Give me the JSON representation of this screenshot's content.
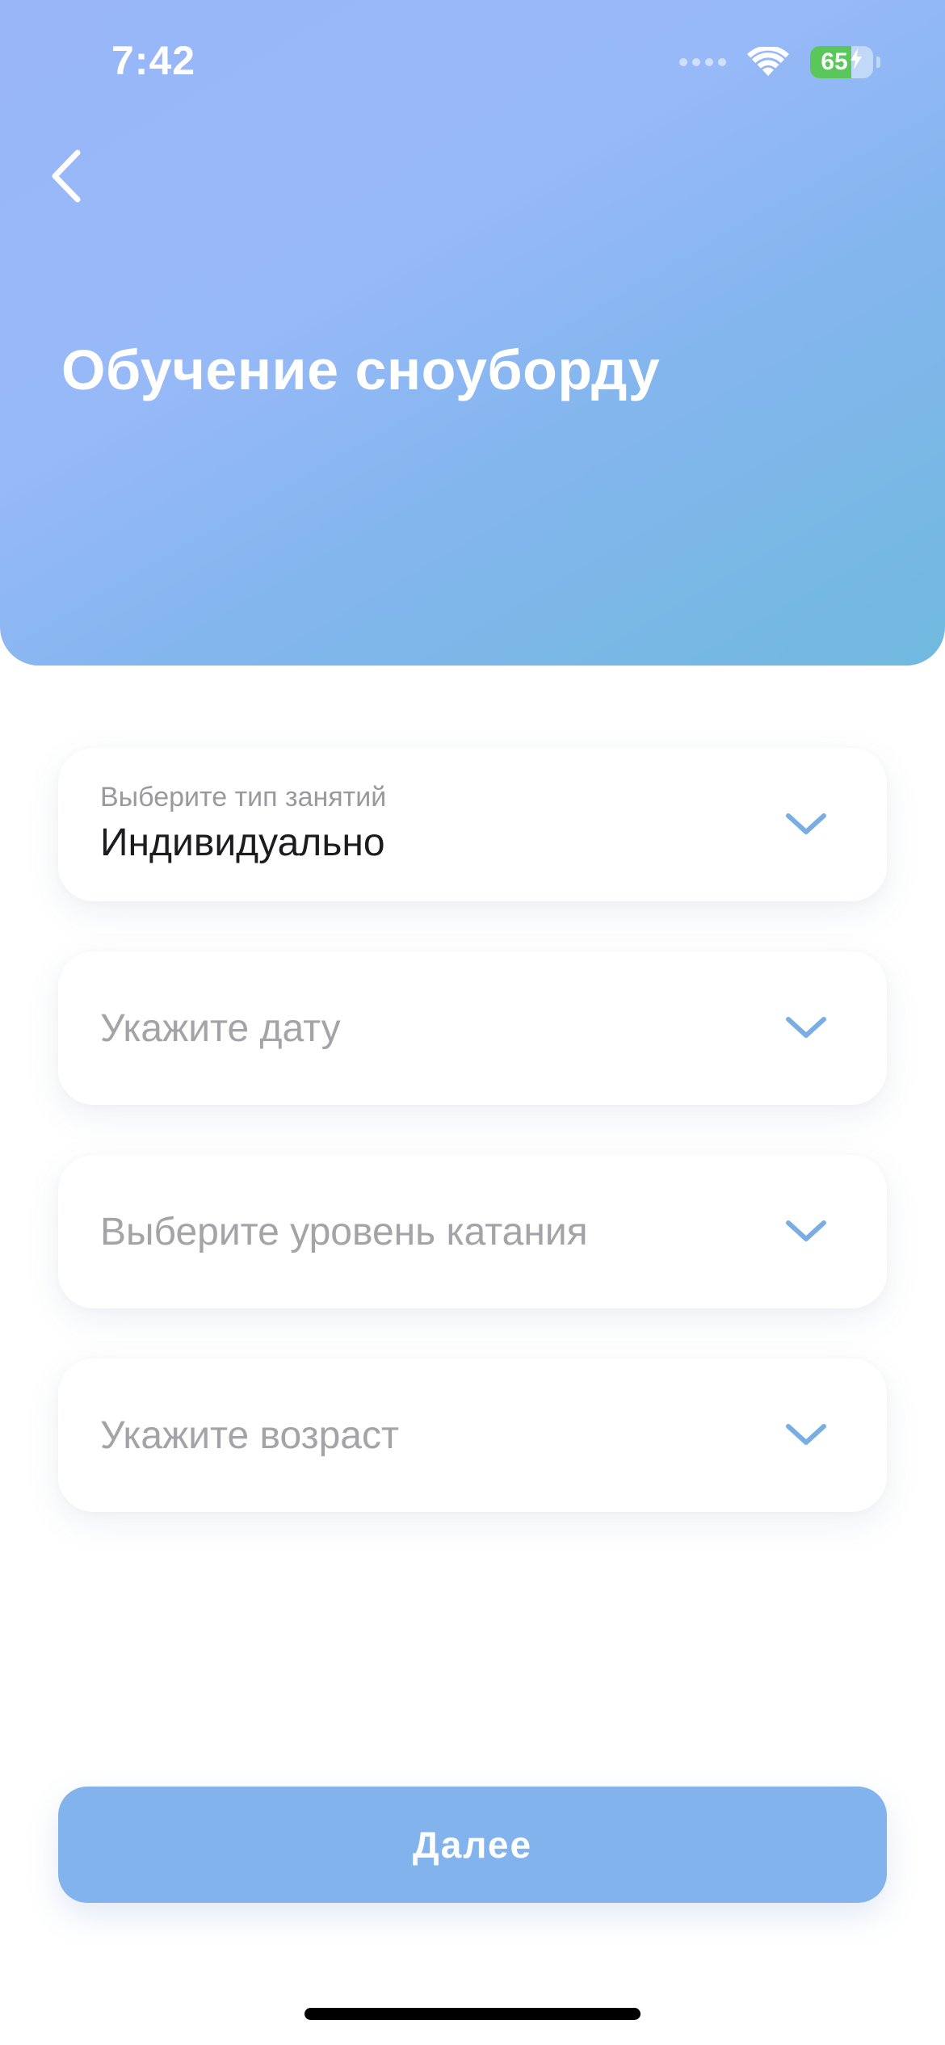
{
  "status_bar": {
    "time": "7:42",
    "battery_percent": "65",
    "battery_level": 0.65,
    "signal_icon": "signal-dots-icon",
    "wifi_icon": "wifi-icon",
    "charging_icon": "bolt-icon"
  },
  "header": {
    "back_icon": "chevron-left-icon",
    "title": "Обучение сноуборду",
    "gradient_colors": [
      "#98b6f8",
      "#84b6ee",
      "#70b9df"
    ]
  },
  "form": {
    "lesson_type": {
      "label": "Выберите тип занятий",
      "value": "Индивидуально",
      "icon": "chevron-down-icon"
    },
    "date": {
      "placeholder": "Укажите дату",
      "icon": "chevron-down-icon"
    },
    "level": {
      "placeholder": "Выберите уровень катания",
      "icon": "chevron-down-icon"
    },
    "age": {
      "placeholder": "Укажите возраст",
      "icon": "chevron-down-icon"
    }
  },
  "footer": {
    "next_label": "Далее",
    "button_color": "#83b3ec"
  },
  "colors": {
    "accent": "#83b3ec",
    "chevron": "#7aaee3",
    "placeholder": "#a3a3a8",
    "text": "#1c1c1e"
  }
}
